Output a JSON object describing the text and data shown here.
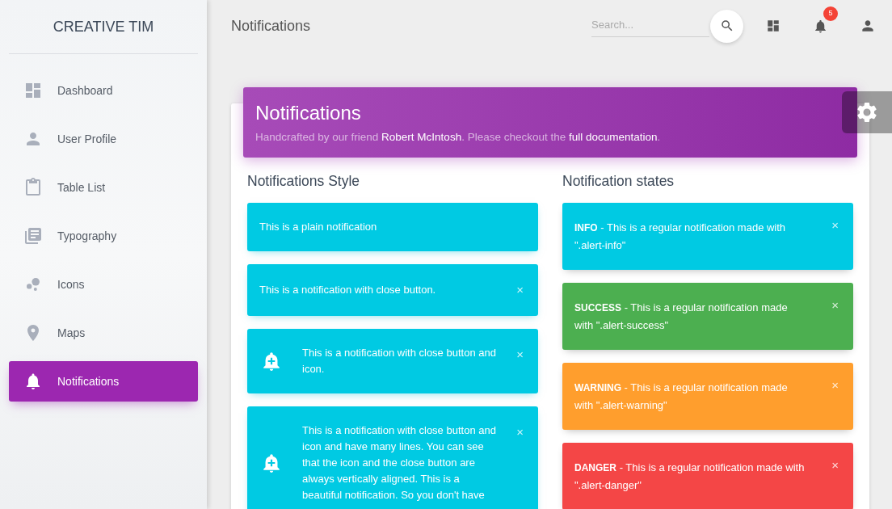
{
  "sidebar": {
    "logo": "CREATIVE TIM",
    "items": [
      {
        "label": "Dashboard",
        "selected": false
      },
      {
        "label": "User Profile",
        "selected": false
      },
      {
        "label": "Table List",
        "selected": false
      },
      {
        "label": "Typography",
        "selected": false
      },
      {
        "label": "Icons",
        "selected": false
      },
      {
        "label": "Maps",
        "selected": false
      },
      {
        "label": "Notifications",
        "selected": true
      }
    ]
  },
  "navbar": {
    "title": "Notifications",
    "search": {
      "placeholder": "Search..."
    },
    "notification_count": "5"
  },
  "header": {
    "title": "Notifications",
    "subtitle": {
      "before": "Handcrafted by our friend ",
      "author_link": "Robert McIntosh",
      "middle": ". Please checkout the ",
      "docs_link": "full documentation",
      "after": "."
    }
  },
  "styles": {
    "title": "Notifications Style",
    "alerts": [
      {
        "kind": "plain",
        "text": "This is a plain notification"
      },
      {
        "kind": "closable",
        "text": "This is a notification with close button.",
        "close": "×"
      },
      {
        "kind": "icon",
        "text": "This is a notification with close button and icon.",
        "close": "×"
      },
      {
        "kind": "icon",
        "text": "This is a notification with close button and icon and have many lines. You can see that the icon and the close button are always vertically aligned. This is a beautiful notification. So you don't have",
        "close": "×"
      }
    ]
  },
  "states": {
    "title": "Notification states",
    "alerts": [
      {
        "color": "#00cae3",
        "text": "**INFO** - This is a regular notification made with \".alert-info\"",
        "close": "×"
      },
      {
        "color": "#4caf50",
        "text": "**SUCCESS** - This is a regular notification made with \".alert-success\"",
        "close": "×"
      },
      {
        "color": "#ff9e2d",
        "text": "**WARNING** - This is a regular notification made with \".alert-warning\"",
        "close": "×"
      },
      {
        "color": "#f44646",
        "text": "**DANGER** - This is a regular notification made with \".alert-danger\"",
        "close": "×"
      }
    ]
  }
}
